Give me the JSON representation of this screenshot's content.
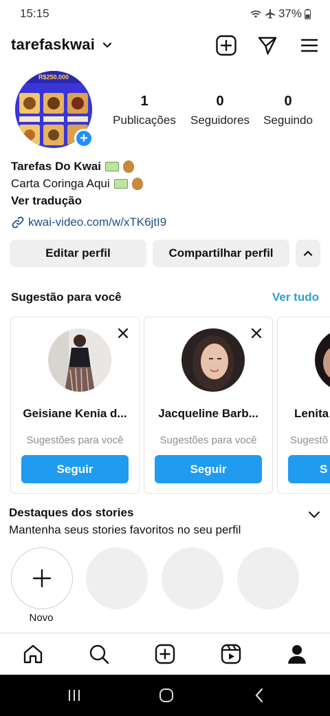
{
  "status_bar": {
    "time": "15:15",
    "battery": "37%"
  },
  "header": {
    "username": "tarefaskwai"
  },
  "profile": {
    "stats": [
      {
        "value": "1",
        "label": "Publicações"
      },
      {
        "value": "0",
        "label": "Seguidores"
      },
      {
        "value": "0",
        "label": "Seguindo"
      }
    ],
    "avatar_caption": "R$250.000",
    "bio_name": "Tarefas Do Kwai",
    "bio_line": "Carta Coringa Aqui",
    "see_translation": "Ver tradução",
    "link": "kwai-video.com/w/xTK6jtI9"
  },
  "actions": {
    "edit_profile": "Editar perfil",
    "share_profile": "Compartilhar perfil"
  },
  "suggestions": {
    "title": "Sugestão para você",
    "see_all": "Ver tudo",
    "cards": [
      {
        "name": "Geisiane Kenia d...",
        "subtitle": "Sugestões para você",
        "follow": "Seguir"
      },
      {
        "name": "Jacqueline Barb...",
        "subtitle": "Sugestões para você",
        "follow": "Seguir"
      },
      {
        "name": "Lenita",
        "subtitle": "Sugestõ",
        "follow": "S"
      }
    ]
  },
  "highlights": {
    "title": "Destaques dos stories",
    "subtitle": "Mantenha seus stories favoritos no seu perfil",
    "new_label": "Novo"
  },
  "colors": {
    "accent_blue": "#1f9bf0",
    "link_blue": "#1b4f91",
    "see_all_blue": "#2aa0d8",
    "button_gray": "#efefef"
  }
}
